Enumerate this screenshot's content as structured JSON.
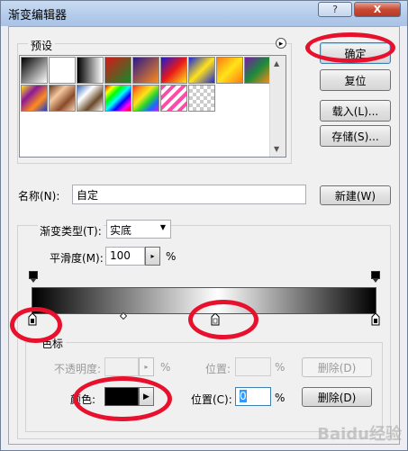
{
  "window": {
    "title": "渐变编辑器"
  },
  "titlebar": {
    "help_glyph": "?",
    "close_glyph": "X"
  },
  "presets": {
    "label": "预设",
    "menu_glyph": "▸",
    "swatches": [
      {
        "name": "fg-to-bg",
        "css": "linear-gradient(135deg,#000,#fff)"
      },
      {
        "name": "fg-to-transparent",
        "css": "linear-gradient(135deg,#ffffff,rgba(255,255,255,0))"
      },
      {
        "name": "black-white",
        "css": "linear-gradient(90deg,#000,#fff)"
      },
      {
        "name": "red-green",
        "css": "linear-gradient(135deg,#d81818,#118a2a)"
      },
      {
        "name": "violet-orange",
        "css": "linear-gradient(135deg,#2a1a8a,#ff8c1a)"
      },
      {
        "name": "blue-red-yellow",
        "css": "linear-gradient(135deg,#1a1ad8,#e81818,#ffe31a)"
      },
      {
        "name": "blue-yellow-blue",
        "css": "linear-gradient(135deg,#1a2ad8,#ffe31a,#1a2ad8)"
      },
      {
        "name": "orange-yellow-orange",
        "css": "linear-gradient(135deg,#ff7a10,#ffe31a,#ff7a10)"
      },
      {
        "name": "violet-green-orange",
        "css": "linear-gradient(135deg,#7a1aa8,#1a8a3a,#ff8c1a)"
      },
      {
        "name": "yellow-violet-orange-blue",
        "css": "linear-gradient(135deg,#ffe31a,#8a1a9a,#ff8c1a,#1a3ad8)"
      },
      {
        "name": "copper",
        "css": "linear-gradient(135deg,#6a3a1a,#f4c8a0,#8a4a2a,#f6d6b8)"
      },
      {
        "name": "chrome",
        "css": "linear-gradient(135deg,#3a6ab8,#ffffff,#6a4a2a,#ffffff)"
      },
      {
        "name": "spectrum",
        "css": "linear-gradient(135deg,#ff0000,#ffff00,#00ff00,#00ffff,#0000ff,#ff00ff,#ff0000)"
      },
      {
        "name": "transparent-rainbow",
        "css": "linear-gradient(135deg,#ff2a2a,#ff9a1a,#ffe31a,#2ad82a,#1a6aff,#c81aff)"
      },
      {
        "name": "transparent-stripes",
        "css": "repeating-linear-gradient(135deg,#ff4aa8 0 4px,#ffffff 4px 8px)"
      },
      {
        "name": "transparent-checker",
        "css": ""
      }
    ]
  },
  "buttons": {
    "ok": "确定",
    "reset": "复位",
    "load": "载入(L)...",
    "save": "存储(S)...",
    "new": "新建(W)"
  },
  "name": {
    "label": "名称(N):",
    "value": "自定"
  },
  "gradient_type": {
    "label": "渐变类型(T):",
    "value": "实底"
  },
  "smoothness": {
    "label": "平滑度(M):",
    "value": "100",
    "unit": "%"
  },
  "stops_group": {
    "label": "色标",
    "opacity_label": "不透明度:",
    "opacity_value": "",
    "opacity_unit": "%",
    "opacity_position_label": "位置:",
    "opacity_position_value": "",
    "opacity_position_unit": "%",
    "opacity_delete": "删除(D)",
    "color_label": "颜色:",
    "color_value": "#000000",
    "color_position_label": "位置(C):",
    "color_position_value": "0",
    "color_position_unit": "%",
    "color_delete": "删除(D)"
  },
  "watermark": "Baidu经验"
}
